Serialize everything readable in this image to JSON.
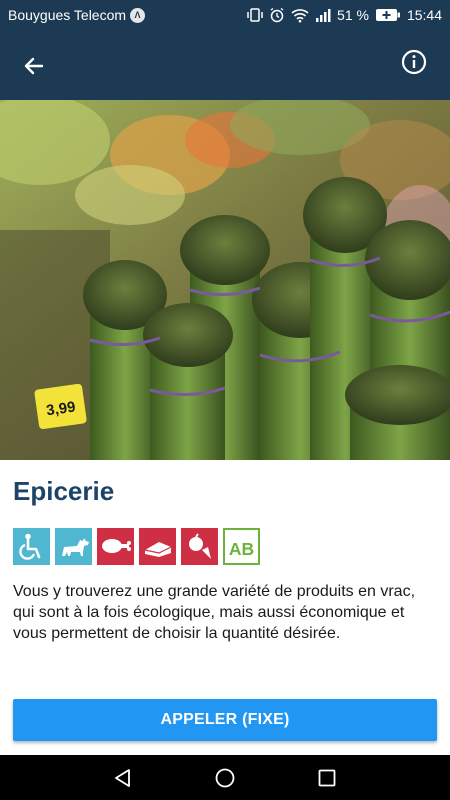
{
  "status_bar": {
    "carrier": "Bouygues Telecom",
    "carrier_badge": "Λ",
    "battery": "51 %",
    "time": "15:44",
    "icons": [
      "vibrate-icon",
      "alarm-icon",
      "wifi-icon",
      "signal-icon",
      "battery-icon"
    ]
  },
  "app_bar": {
    "back_icon": "arrow-left-icon",
    "info_icon": "info-circle-icon",
    "color": "#1d3a55"
  },
  "hero": {
    "image": "asparagus-bunches-photo",
    "price_tag": "3,99"
  },
  "content": {
    "title": "Epicerie",
    "badges": [
      {
        "icon": "wheelchair-icon",
        "color": "#4fb7cf"
      },
      {
        "icon": "dog-icon",
        "color": "#4fb7cf"
      },
      {
        "icon": "ham-icon",
        "color": "#cf2f45"
      },
      {
        "icon": "cheese-icon",
        "color": "#cf2f45"
      },
      {
        "icon": "fruit-vegetable-icon",
        "color": "#cf2f45"
      },
      {
        "icon": "organic-ab-icon",
        "color": "#6cb33e",
        "text": "AB"
      }
    ],
    "description": "Vous y trouverez une grande variété de produits en vrac, qui sont à la fois écologique, mais aussi économique et vous permettent de choisir la quantité désirée."
  },
  "actions": {
    "call_label": "APPELER (FIXE)",
    "call_color": "#2196f3"
  },
  "nav_bar": {
    "icons": [
      "back-triangle-icon",
      "home-circle-icon",
      "recents-square-icon"
    ]
  }
}
